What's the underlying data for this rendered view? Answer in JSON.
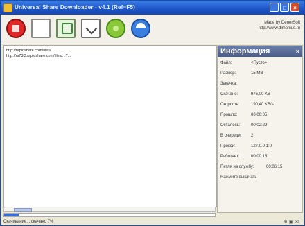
{
  "window": {
    "title": "Universal Share Downloader - v4.1 (Ref=F5)",
    "min_glyph": "_",
    "max_glyph": "□",
    "close_glyph": "×"
  },
  "toolbar": {
    "made_by_line1": "Made by DenerSoft",
    "made_by_line2": "http://www.dimonius.ru"
  },
  "log": {
    "lines": [
      "http://rapidshare.com/files/...",
      "http://rs73l3.rapidshare.com/files/...?..."
    ]
  },
  "info_panel": {
    "title": "Информация",
    "close_glyph": "×",
    "rows": [
      {
        "label": "Файл:",
        "value": "<Пусто>"
      },
      {
        "label": "Размер:",
        "value": "15 MB"
      },
      {
        "label": "Закачка:",
        "value": ""
      },
      {
        "label": "Скачано:",
        "value": "976,00 KB"
      },
      {
        "label": "Скорость:",
        "value": "190,40 KB/s"
      },
      {
        "label": "Прошло:",
        "value": "00:00:05"
      },
      {
        "label": "Осталось:",
        "value": "00:02:29"
      },
      {
        "label": "В очереди:",
        "value": "2"
      },
      {
        "label": "Прокси:",
        "value": "127.0.0.1:0"
      },
      {
        "label": "Работает:",
        "value": "00:00:15"
      },
      {
        "label": "Петля на службу:",
        "value": "00:06:15"
      },
      {
        "label": "Нажмите выкачать",
        "value": ""
      }
    ]
  },
  "progress": {
    "percent": 7
  },
  "status": {
    "text": "Скачивание... скачано 7%",
    "icons": "⊕ ▣ ✉"
  }
}
